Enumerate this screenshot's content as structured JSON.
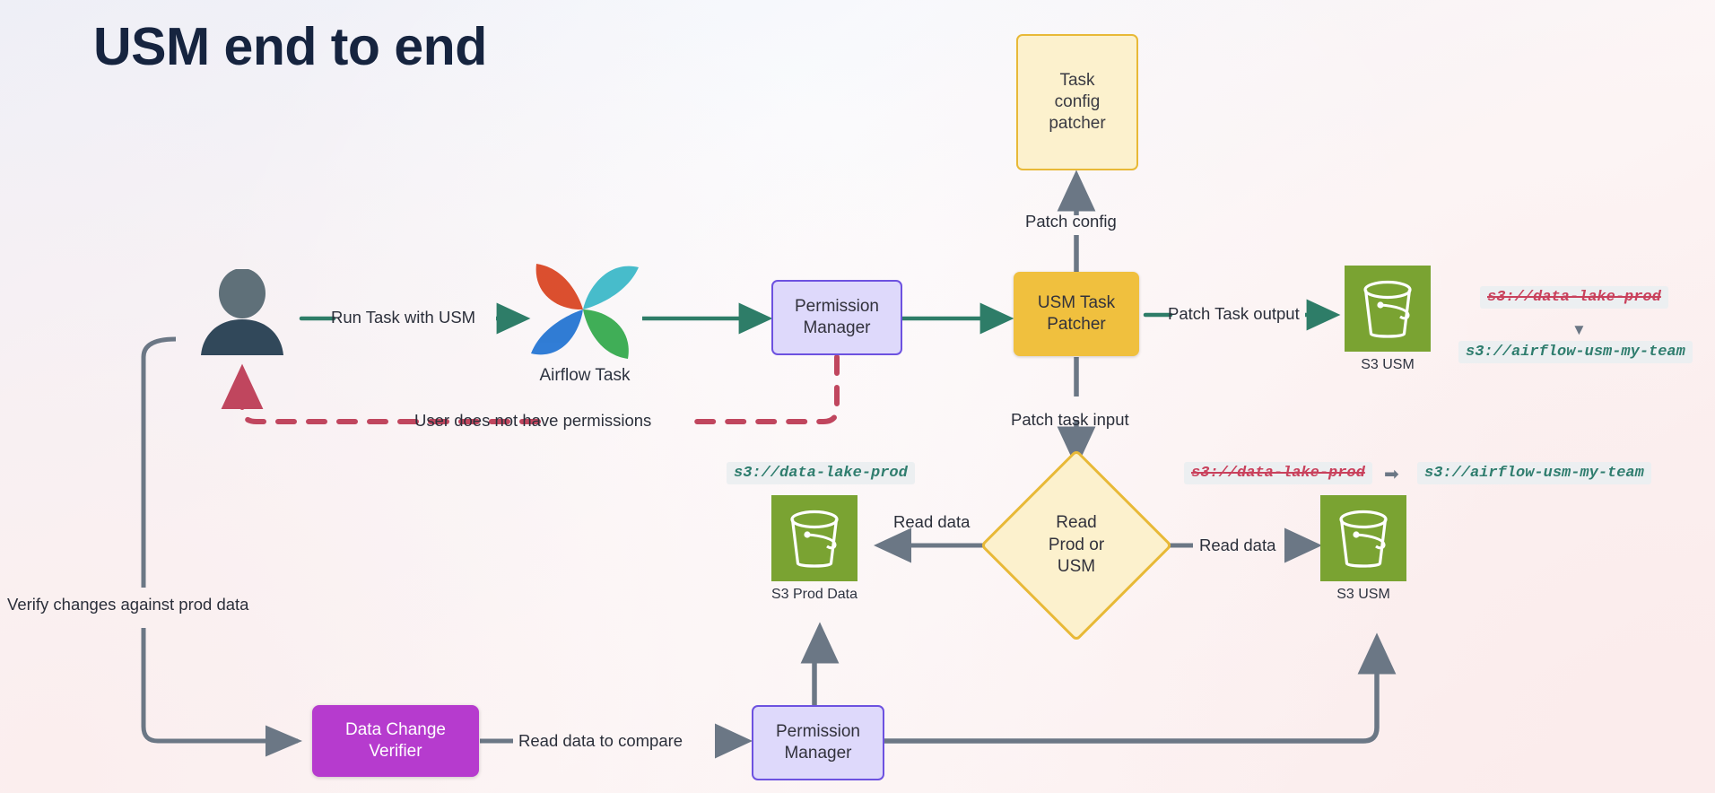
{
  "page": {
    "title": "USM end to end",
    "title_color": "#16243f",
    "bg_from": "#eaeff9",
    "bg_to": "#faeeee"
  },
  "palette": {
    "green_arrow": "#2e7d68",
    "gray_arrow": "#6b7785",
    "red_dashed": "#c0465e",
    "s3_green": "#7aa332",
    "amber": "#f0c03e",
    "amber_light": "#fcf1cd",
    "amber_border": "#e8b937",
    "lavender": "#ded9fb",
    "lavender_border": "#6d52e0",
    "magenta": "#b63bce",
    "code_red": "#c9415c",
    "code_green": "#2f7d6e"
  },
  "nodes": {
    "user": {
      "name": "User"
    },
    "airflow_task": {
      "label": "Airflow Task"
    },
    "permission_manager_top": {
      "label": "Permission\nManager",
      "line1": "Permission",
      "line2": "Manager"
    },
    "usm_task_patcher": {
      "line1": "USM Task",
      "line2": "Patcher"
    },
    "task_config_patcher": {
      "line1": "Task",
      "line2": "config",
      "line3": "patcher"
    },
    "s3_usm_top": {
      "caption": "S3 USM"
    },
    "read_prod_or_usm": {
      "line1": "Read",
      "line2": "Prod or",
      "line3": "USM"
    },
    "s3_prod_data": {
      "caption": "S3 Prod Data"
    },
    "s3_usm_mid": {
      "caption": "S3 USM"
    },
    "data_change_verifier": {
      "line1": "Data Change",
      "line2": "Verifier"
    },
    "permission_manager_bottom": {
      "line1": "Permission",
      "line2": "Manager"
    }
  },
  "edges": {
    "run_task_with_usm": "Run Task with USM",
    "user_no_permissions": "User does not have permissions",
    "patch_config": "Patch config",
    "patch_task_output": "Patch Task output",
    "patch_task_input": "Patch task input",
    "read_data_left": "Read data",
    "read_data_right": "Read data",
    "verify_changes": "Verify changes against prod data",
    "read_data_to_compare": "Read data to compare"
  },
  "code_labels": {
    "s3_usm_top_old": "s3://data-lake-prod",
    "s3_usm_top_new": "s3://airflow-usm-my-team",
    "s3_prod_path": "s3://data-lake-prod",
    "s3_usm_mid_old": "s3://data-lake-prod",
    "s3_usm_mid_new": "s3://airflow-usm-my-team"
  }
}
